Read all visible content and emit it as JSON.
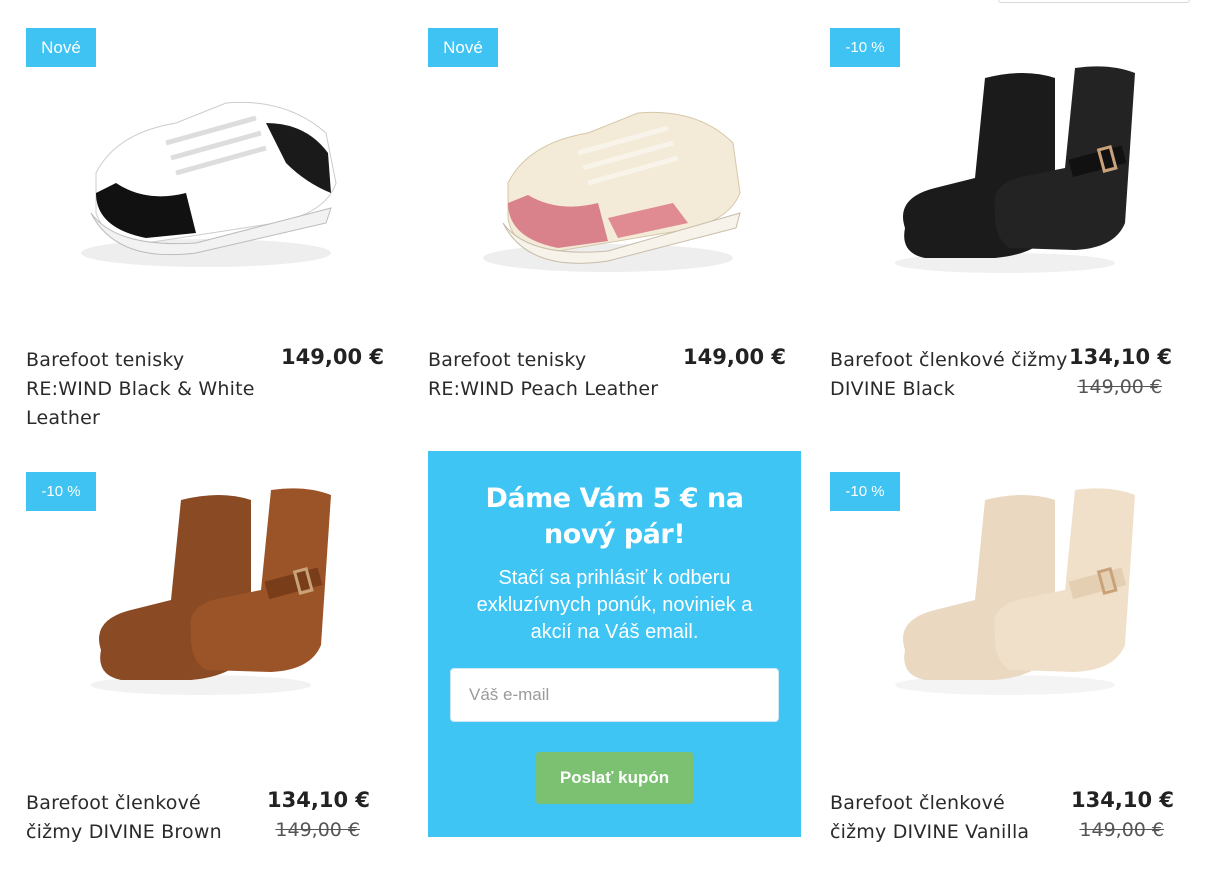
{
  "products": [
    {
      "badge": "Nové",
      "name": "Barefoot tenisky RE:WIND Black & White Leather",
      "price": "149,00 €",
      "old_price": ""
    },
    {
      "badge": "Nové",
      "name": "Barefoot tenisky RE:WIND Peach Leather",
      "price": "149,00 €",
      "old_price": ""
    },
    {
      "badge": "-10 %",
      "name": "Barefoot členkové čižmy DIVINE Black",
      "price": "134,10 €",
      "old_price": "149,00 €"
    },
    {
      "badge": "-10 %",
      "name": "Barefoot členkové čižmy DIVINE Brown",
      "price": "134,10 €",
      "old_price": "149,00 €"
    },
    {
      "badge": "-10 %",
      "name": "Barefoot členkové čižmy DIVINE Vanilla",
      "price": "134,10 €",
      "old_price": "149,00 €"
    }
  ],
  "promo": {
    "title": "Dáme Vám 5 € na nový pár!",
    "text": "Stačí sa prihlásiť k odberu exkluzívnych ponúk, noviniek a akcií na Váš email.",
    "email_placeholder": "Váš e-mail",
    "button": "Poslať kupón"
  },
  "colors": {
    "badge": "#3ec3f2",
    "promo_bg": "#3ec5f4",
    "button": "#7cc072"
  },
  "icons": [
    "sneaker-black-white-image",
    "sneaker-peach-image",
    "boot-black-image",
    "boot-brown-image",
    "boot-vanilla-image"
  ]
}
